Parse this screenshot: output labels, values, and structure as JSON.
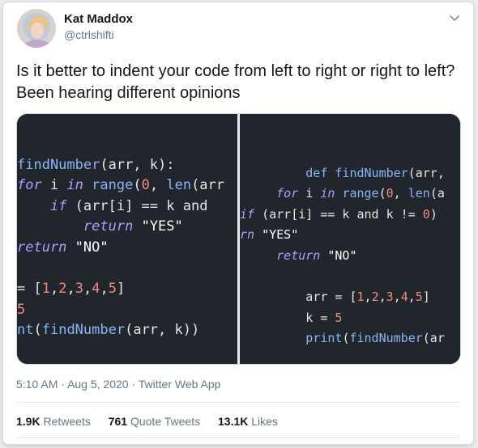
{
  "author": {
    "name": "Kat Maddox",
    "handle": "@ctrlshifti"
  },
  "tweet": {
    "text": "Is it better to indent your code from left to right or right to left? Been hearing different opinions"
  },
  "meta": {
    "time": "5:10 AM",
    "date": "Aug 5, 2020",
    "source": "Twitter Web App",
    "separator": "·"
  },
  "stats": {
    "retweets": {
      "count": "1.9K",
      "label": "Retweets"
    },
    "quotes": {
      "count": "761",
      "label": "Quote Tweets"
    },
    "likes": {
      "count": "13.1K",
      "label": "Likes"
    }
  },
  "media": {
    "left_code": [
      "findNumber(arr, k):",
      "for i in range(0, len(arr",
      "    if (arr[i] == k and",
      "        return \"YES\"",
      "return \"NO\"",
      "",
      "= [1,2,3,4,5]",
      "5",
      "nt(findNumber(arr, k))"
    ],
    "right_code": [
      "        def findNumber(arr,",
      "     for i in range(0, len(a",
      "if (arr[i] == k and k != 0)",
      "rn \"YES\"",
      "     return \"NO\"",
      "",
      "        arr = [1,2,3,4,5]",
      "        k = 5",
      "        print(findNumber(ar"
    ]
  },
  "icons": {
    "chevron": "chevron-down-icon",
    "avatar": "avatar"
  }
}
